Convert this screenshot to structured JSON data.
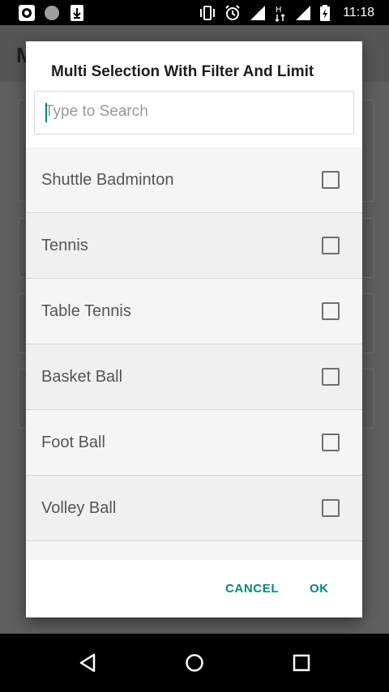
{
  "status_bar": {
    "time": "11:18",
    "left_icons": [
      "app-notification-icon",
      "circle-notification-icon",
      "download-notification-icon"
    ],
    "right_icons": [
      "vibrate-icon",
      "alarm-icon",
      "signal-icon",
      "data-h-icon",
      "signal-icon",
      "battery-charging-icon"
    ]
  },
  "background_app": {
    "title_partial": "M"
  },
  "dialog": {
    "title": "Multi Selection With Filter And Limit",
    "search": {
      "placeholder": "Type to Search",
      "value": ""
    },
    "items": [
      {
        "label": "Shuttle Badminton",
        "checked": false
      },
      {
        "label": "Tennis",
        "checked": false
      },
      {
        "label": "Table Tennis",
        "checked": false
      },
      {
        "label": "Basket Ball",
        "checked": false
      },
      {
        "label": "Foot Ball",
        "checked": false
      },
      {
        "label": "Volley Ball",
        "checked": false
      }
    ],
    "actions": {
      "cancel": "CANCEL",
      "ok": "OK"
    }
  },
  "colors": {
    "accent": "#00897b",
    "status_bar": "#000000",
    "nav_bar": "#000000",
    "scrim": "#5f5f5f"
  },
  "nav_bar": {
    "buttons": [
      "back-icon",
      "home-icon",
      "recents-icon"
    ]
  }
}
